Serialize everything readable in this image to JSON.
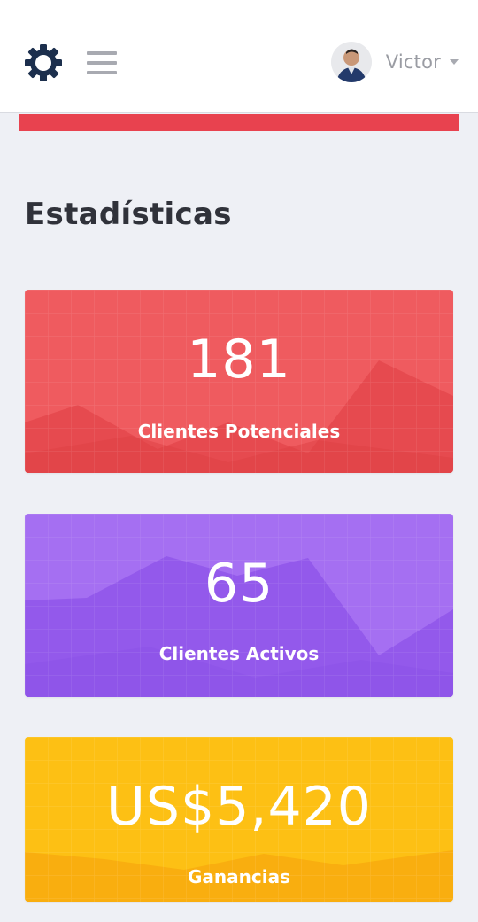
{
  "header": {
    "username": "Victor",
    "icons": {
      "settings": "gear-icon",
      "menu": "hamburger-menu-icon",
      "dropdown": "caret-down-icon"
    }
  },
  "page": {
    "section_title": "Estadísticas"
  },
  "stats": [
    {
      "value": "181",
      "label": "Clientes Potenciales",
      "color": "#ef5257"
    },
    {
      "value": "65",
      "label": "Clientes Activos",
      "color": "#a36cf0"
    },
    {
      "value": "US$5,420",
      "label": "Ganancias",
      "color": "#fdbf12"
    }
  ],
  "colors": {
    "accent_red": "#e8424f",
    "title_text": "#30323a",
    "background": "#eef0f5"
  }
}
